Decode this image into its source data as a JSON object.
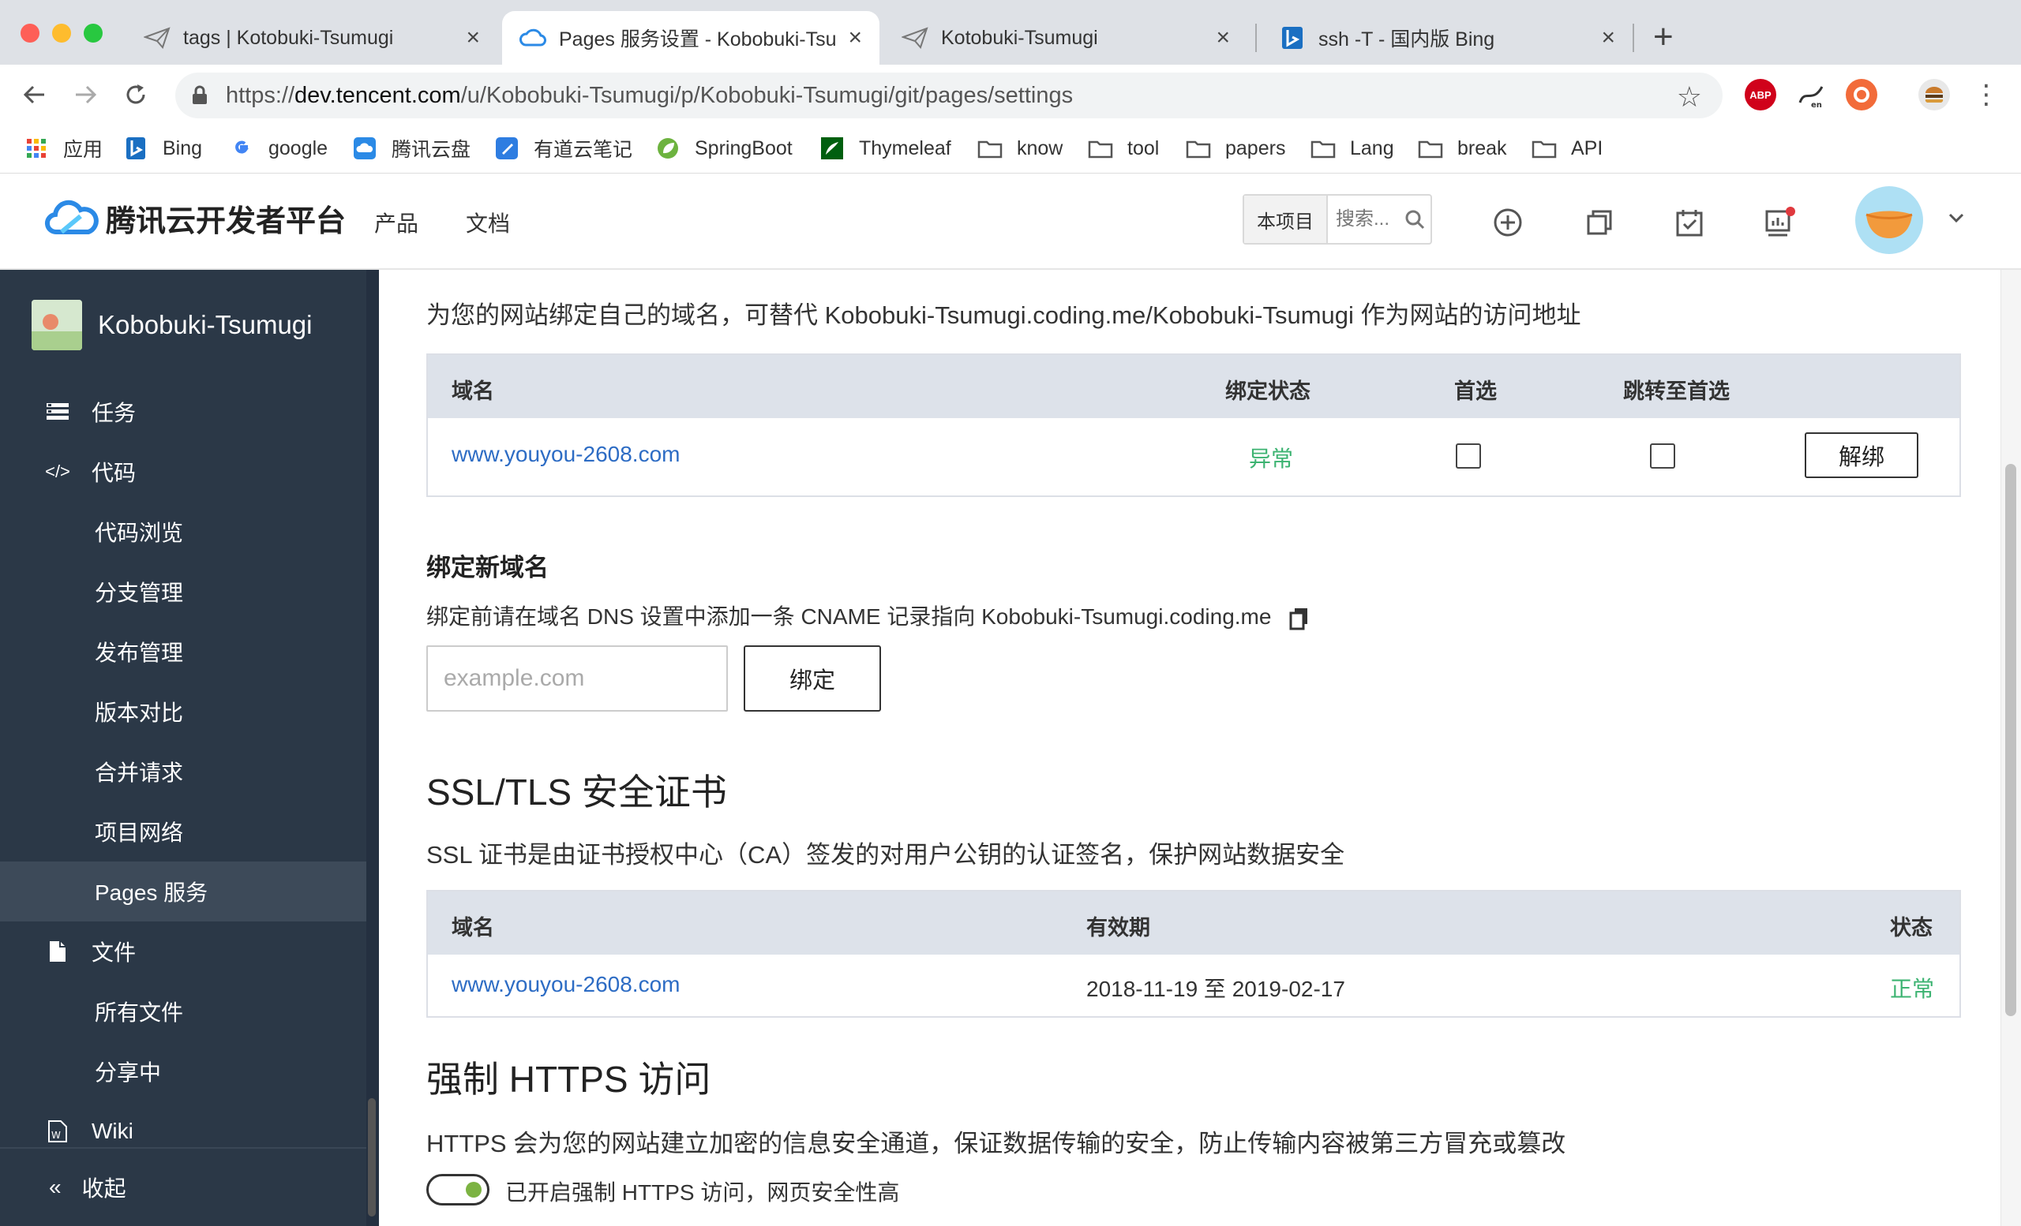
{
  "browser": {
    "tabs": [
      {
        "title": "tags | Kotobuki-Tsumugi",
        "active": false
      },
      {
        "title": "Pages 服务设置 - Kobobuki-Tsu",
        "active": true
      },
      {
        "title": "Kotobuki-Tsumugi",
        "active": false
      },
      {
        "title": "ssh -T - 国内版 Bing",
        "active": false
      }
    ],
    "url_prefix": "https://",
    "url_host": "dev.tencent.com",
    "url_path": "/u/Kobobuki-Tsumugi/p/Kobobuki-Tsumugi/git/pages/settings",
    "extensions": [
      "ABP"
    ],
    "bookmarks": [
      "应用",
      "Bing",
      "google",
      "腾讯云盘",
      "有道云笔记",
      "SpringBoot",
      "Thymeleaf",
      "know",
      "tool",
      "papers",
      "Lang",
      "break",
      "API"
    ]
  },
  "header": {
    "brand": "腾讯云开发者平台",
    "nav": [
      "产品",
      "文档"
    ],
    "search_scope": "本项目",
    "search_placeholder": "搜索..."
  },
  "sidebar": {
    "project_name": "Kobobuki-Tsumugi",
    "items": [
      {
        "label": "任务",
        "level": "top",
        "icon": "task-icon"
      },
      {
        "label": "代码",
        "level": "top",
        "icon": "code-icon"
      },
      {
        "label": "代码浏览",
        "level": "sub"
      },
      {
        "label": "分支管理",
        "level": "sub"
      },
      {
        "label": "发布管理",
        "level": "sub"
      },
      {
        "label": "版本对比",
        "level": "sub"
      },
      {
        "label": "合并请求",
        "level": "sub"
      },
      {
        "label": "项目网络",
        "level": "sub"
      },
      {
        "label": "Pages 服务",
        "level": "sub",
        "active": true
      },
      {
        "label": "文件",
        "level": "top",
        "icon": "file-icon"
      },
      {
        "label": "所有文件",
        "level": "sub"
      },
      {
        "label": "分享中",
        "level": "sub"
      },
      {
        "label": "Wiki",
        "level": "top",
        "icon": "wiki-icon"
      }
    ],
    "collapse_label": "收起"
  },
  "domain_binding": {
    "description": "为您的网站绑定自己的域名，可替代 Kobobuki-Tsumugi.coding.me/Kobobuki-Tsumugi 作为网站的访问地址",
    "columns": [
      "域名",
      "绑定状态",
      "首选",
      "跳转至首选"
    ],
    "rows": [
      {
        "domain": "www.youyou-2608.com",
        "status": "异常",
        "preferred": false,
        "redirect": false,
        "action": "解绑"
      }
    ]
  },
  "bind_new": {
    "title": "绑定新域名",
    "hint": "绑定前请在域名 DNS 设置中添加一条 CNAME 记录指向 Kobobuki-Tsumugi.coding.me",
    "input_placeholder": "example.com",
    "button": "绑定"
  },
  "ssl": {
    "title": "SSL/TLS 安全证书",
    "description": "SSL 证书是由证书授权中心（CA）签发的对用户公钥的认证签名，保护网站数据安全",
    "columns": [
      "域名",
      "有效期",
      "状态"
    ],
    "rows": [
      {
        "domain": "www.youyou-2608.com",
        "validity": "2018-11-19 至 2019-02-17",
        "status": "正常"
      }
    ]
  },
  "https": {
    "title": "强制 HTTPS 访问",
    "description": "HTTPS 会为您的网站建立加密的信息安全通道，保证数据传输的安全，防止传输内容被第三方冒充或篡改",
    "toggle_label": "已开启强制 HTTPS 访问，网页安全性高",
    "enabled": true
  },
  "colors": {
    "sidebar_bg": "#2b3847",
    "sidebar_active": "#3d4a59",
    "link": "#2d6cc4",
    "status_green": "#3cb371",
    "table_header": "#dde2ea"
  }
}
